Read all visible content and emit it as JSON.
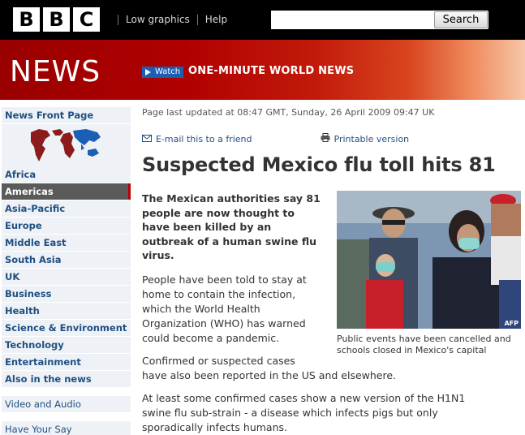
{
  "header": {
    "logo_letters": [
      "B",
      "B",
      "C"
    ],
    "links": [
      "Low graphics",
      "Help"
    ],
    "search_placeholder": "",
    "search_button": "Search"
  },
  "banner": {
    "section": "NEWS",
    "watch_label": "Watch",
    "program": "ONE-MINUTE WORLD NEWS"
  },
  "nav": {
    "front_page": "News Front Page",
    "items": [
      {
        "label": "Africa"
      },
      {
        "label": "Americas",
        "active": true
      },
      {
        "label": "Asia-Pacific"
      },
      {
        "label": "Europe"
      },
      {
        "label": "Middle East"
      },
      {
        "label": "South Asia"
      },
      {
        "label": "UK"
      },
      {
        "label": "Business"
      },
      {
        "label": "Health"
      },
      {
        "label": "Science & Environment"
      },
      {
        "label": "Technology"
      },
      {
        "label": "Entertainment"
      },
      {
        "label": "Also in the news"
      }
    ],
    "secondary": [
      "Video and Audio",
      "Have Your Say"
    ]
  },
  "article": {
    "updated": "Page last updated at 08:47 GMT, Sunday, 26 April 2009 09:47 UK",
    "email_link": "E-mail this to a friend",
    "print_link": "Printable version",
    "headline": "Suspected Mexico flu toll hits 81",
    "lead_lines": [
      "The Mexican authorities say 81",
      "people are now thought to",
      "have been killed by an",
      "outbreak of a human swine flu",
      "virus."
    ],
    "para1_lines": [
      "People have been told to stay at",
      "home to contain the infection,",
      "which the World Health",
      "Organization (WHO) has warned",
      "could become a pandemic."
    ],
    "para2_lines": [
      "Confirmed or suspected cases",
      "have also been reported in the US and elsewhere."
    ],
    "para3_lines": [
      "At least some confirmed cases show a new version of the H1N1",
      "swine flu sub-strain - a disease which infects pigs but only",
      "sporadically infects humans."
    ],
    "photo_credit": "AFP",
    "caption": "Public events have been cancelled and schools closed in Mexico's capital"
  },
  "colors": {
    "link_blue": "#1f4f82",
    "nav_bg": "#eef2f6",
    "banner_red": "#b00000"
  }
}
